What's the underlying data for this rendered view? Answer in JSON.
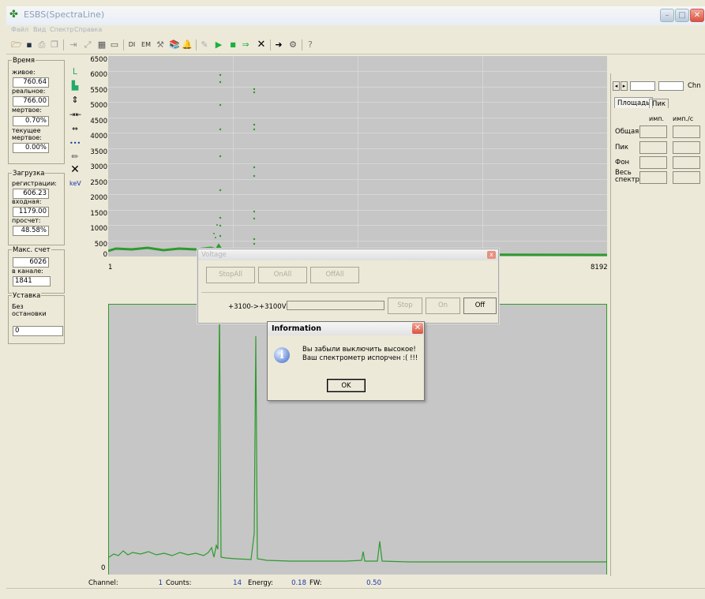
{
  "window": {
    "title": "ESBS(SpectraLine)"
  },
  "menu": [
    "Файл",
    "Вид",
    "Спектр",
    "Справка"
  ],
  "stats": {
    "time_title": "Время",
    "live_label": "живое:",
    "live_value": "760.64",
    "real_label": "реальное:",
    "real_value": "766.00",
    "dead_label": "мертвое:",
    "dead_value": "0.70%",
    "curdead_label": "текущее мертвое:",
    "curdead_value": "0.00%",
    "load_title": "Загрузка",
    "reg_label": "регистрации:",
    "reg_value": "606.23",
    "input_label": "входная:",
    "input_value": "1179.00",
    "pass_label": "просчет:",
    "pass_value": "48.58%",
    "max_title": "Макс. счет",
    "max_value": "6026",
    "chan_label": "в канале:",
    "chan_value": "1841",
    "set_title": "Уставка",
    "set_label": "Без остановки",
    "set_value": "0"
  },
  "y_tools": {
    "kev_label": "keV"
  },
  "top_axis": {
    "y_ticks": [
      "6500",
      "6000",
      "5500",
      "5000",
      "4500",
      "4000",
      "3500",
      "3000",
      "2500",
      "2000",
      "1500",
      "1000",
      "500",
      "0"
    ],
    "x_min_label": "1",
    "x_max_label": "8192"
  },
  "bottom_axis": {
    "zero_label": "0"
  },
  "status": {
    "channel_label": "Channel:",
    "channel_value": "1",
    "counts_label": "Counts:",
    "counts_value": "14",
    "energy_label": "Energy:",
    "energy_value": "0.18",
    "fw_label": "FW:",
    "fw_value": "0.50"
  },
  "right_panel": {
    "nav_left": "◂",
    "nav_right": "▸",
    "choose_label": "Chn",
    "tabs": [
      "Площадь",
      "Пик"
    ],
    "col1": "имп.",
    "col2": "имп./с",
    "rows": [
      "Общая",
      "Пик",
      "Фон",
      "Весь спектр"
    ]
  },
  "voltage_dialog": {
    "title": "Voltage",
    "stop_all": "StopAll",
    "on_all": "OnAll",
    "off_all": "OffAll",
    "range_label": "+3100->+3100V",
    "stop": "Stop",
    "on": "On",
    "off": "Off"
  },
  "info_dialog": {
    "title": "Information",
    "message_line1": "Вы забыли выключить высокое!",
    "message_line2": "Ваш спектрометр испорчен :( !!!",
    "ok": "OK"
  },
  "colors": {
    "accent": "#2e9a2e",
    "plot_bg": "#c6c6c6"
  }
}
